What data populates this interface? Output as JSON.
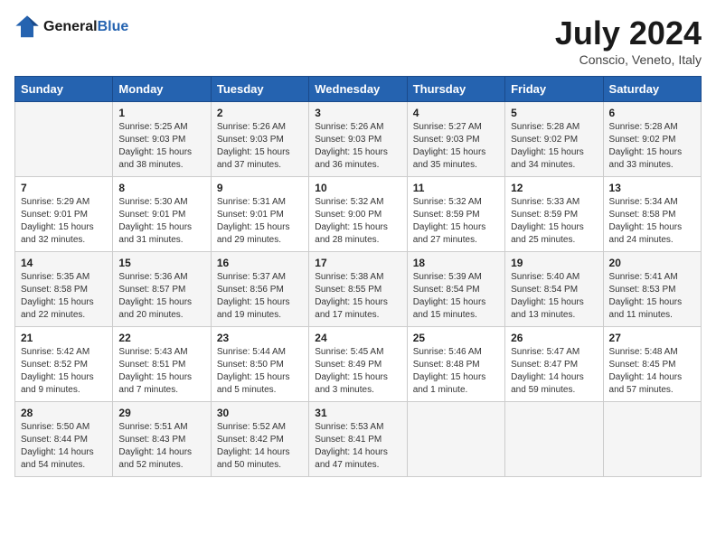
{
  "header": {
    "logo_line1": "General",
    "logo_line2": "Blue",
    "month_title": "July 2024",
    "location": "Conscio, Veneto, Italy"
  },
  "days_of_week": [
    "Sunday",
    "Monday",
    "Tuesday",
    "Wednesday",
    "Thursday",
    "Friday",
    "Saturday"
  ],
  "weeks": [
    [
      {
        "day": "",
        "info": ""
      },
      {
        "day": "1",
        "info": "Sunrise: 5:25 AM\nSunset: 9:03 PM\nDaylight: 15 hours\nand 38 minutes."
      },
      {
        "day": "2",
        "info": "Sunrise: 5:26 AM\nSunset: 9:03 PM\nDaylight: 15 hours\nand 37 minutes."
      },
      {
        "day": "3",
        "info": "Sunrise: 5:26 AM\nSunset: 9:03 PM\nDaylight: 15 hours\nand 36 minutes."
      },
      {
        "day": "4",
        "info": "Sunrise: 5:27 AM\nSunset: 9:03 PM\nDaylight: 15 hours\nand 35 minutes."
      },
      {
        "day": "5",
        "info": "Sunrise: 5:28 AM\nSunset: 9:02 PM\nDaylight: 15 hours\nand 34 minutes."
      },
      {
        "day": "6",
        "info": "Sunrise: 5:28 AM\nSunset: 9:02 PM\nDaylight: 15 hours\nand 33 minutes."
      }
    ],
    [
      {
        "day": "7",
        "info": "Sunrise: 5:29 AM\nSunset: 9:01 PM\nDaylight: 15 hours\nand 32 minutes."
      },
      {
        "day": "8",
        "info": "Sunrise: 5:30 AM\nSunset: 9:01 PM\nDaylight: 15 hours\nand 31 minutes."
      },
      {
        "day": "9",
        "info": "Sunrise: 5:31 AM\nSunset: 9:01 PM\nDaylight: 15 hours\nand 29 minutes."
      },
      {
        "day": "10",
        "info": "Sunrise: 5:32 AM\nSunset: 9:00 PM\nDaylight: 15 hours\nand 28 minutes."
      },
      {
        "day": "11",
        "info": "Sunrise: 5:32 AM\nSunset: 8:59 PM\nDaylight: 15 hours\nand 27 minutes."
      },
      {
        "day": "12",
        "info": "Sunrise: 5:33 AM\nSunset: 8:59 PM\nDaylight: 15 hours\nand 25 minutes."
      },
      {
        "day": "13",
        "info": "Sunrise: 5:34 AM\nSunset: 8:58 PM\nDaylight: 15 hours\nand 24 minutes."
      }
    ],
    [
      {
        "day": "14",
        "info": "Sunrise: 5:35 AM\nSunset: 8:58 PM\nDaylight: 15 hours\nand 22 minutes."
      },
      {
        "day": "15",
        "info": "Sunrise: 5:36 AM\nSunset: 8:57 PM\nDaylight: 15 hours\nand 20 minutes."
      },
      {
        "day": "16",
        "info": "Sunrise: 5:37 AM\nSunset: 8:56 PM\nDaylight: 15 hours\nand 19 minutes."
      },
      {
        "day": "17",
        "info": "Sunrise: 5:38 AM\nSunset: 8:55 PM\nDaylight: 15 hours\nand 17 minutes."
      },
      {
        "day": "18",
        "info": "Sunrise: 5:39 AM\nSunset: 8:54 PM\nDaylight: 15 hours\nand 15 minutes."
      },
      {
        "day": "19",
        "info": "Sunrise: 5:40 AM\nSunset: 8:54 PM\nDaylight: 15 hours\nand 13 minutes."
      },
      {
        "day": "20",
        "info": "Sunrise: 5:41 AM\nSunset: 8:53 PM\nDaylight: 15 hours\nand 11 minutes."
      }
    ],
    [
      {
        "day": "21",
        "info": "Sunrise: 5:42 AM\nSunset: 8:52 PM\nDaylight: 15 hours\nand 9 minutes."
      },
      {
        "day": "22",
        "info": "Sunrise: 5:43 AM\nSunset: 8:51 PM\nDaylight: 15 hours\nand 7 minutes."
      },
      {
        "day": "23",
        "info": "Sunrise: 5:44 AM\nSunset: 8:50 PM\nDaylight: 15 hours\nand 5 minutes."
      },
      {
        "day": "24",
        "info": "Sunrise: 5:45 AM\nSunset: 8:49 PM\nDaylight: 15 hours\nand 3 minutes."
      },
      {
        "day": "25",
        "info": "Sunrise: 5:46 AM\nSunset: 8:48 PM\nDaylight: 15 hours\nand 1 minute."
      },
      {
        "day": "26",
        "info": "Sunrise: 5:47 AM\nSunset: 8:47 PM\nDaylight: 14 hours\nand 59 minutes."
      },
      {
        "day": "27",
        "info": "Sunrise: 5:48 AM\nSunset: 8:45 PM\nDaylight: 14 hours\nand 57 minutes."
      }
    ],
    [
      {
        "day": "28",
        "info": "Sunrise: 5:50 AM\nSunset: 8:44 PM\nDaylight: 14 hours\nand 54 minutes."
      },
      {
        "day": "29",
        "info": "Sunrise: 5:51 AM\nSunset: 8:43 PM\nDaylight: 14 hours\nand 52 minutes."
      },
      {
        "day": "30",
        "info": "Sunrise: 5:52 AM\nSunset: 8:42 PM\nDaylight: 14 hours\nand 50 minutes."
      },
      {
        "day": "31",
        "info": "Sunrise: 5:53 AM\nSunset: 8:41 PM\nDaylight: 14 hours\nand 47 minutes."
      },
      {
        "day": "",
        "info": ""
      },
      {
        "day": "",
        "info": ""
      },
      {
        "day": "",
        "info": ""
      }
    ]
  ]
}
